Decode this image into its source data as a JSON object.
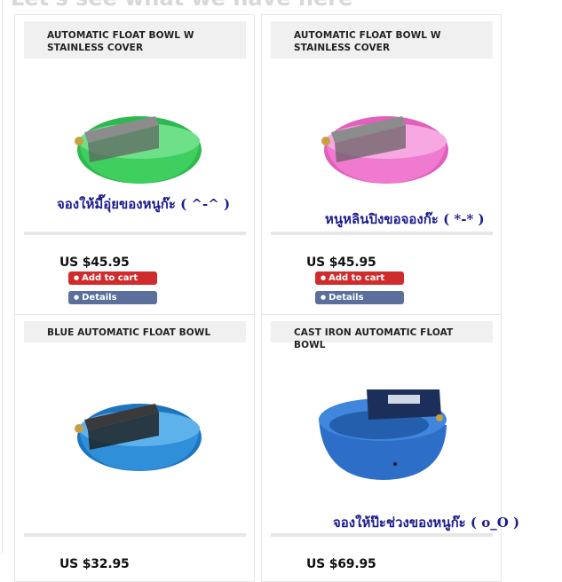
{
  "page": {
    "heading": "Let's see what we have here"
  },
  "products": [
    {
      "title": "AUTOMATIC FLOAT BOWL W STAINLESS COVER",
      "caption": "จองให้มี๊อุ่ยของหนูก๊ะ ( ^-^ )",
      "price": "US $45.95",
      "bowl_color": "#3ecf5e",
      "add_to_cart": "Add to cart",
      "details": "Details"
    },
    {
      "title": "AUTOMATIC FLOAT BOWL W STAINLESS COVER",
      "caption": "หนูหลินปิงขอจองก๊ะ ( *-* )",
      "price": "US $45.95",
      "bowl_color": "#f07ad0",
      "add_to_cart": "Add to cart",
      "details": "Details"
    },
    {
      "title": "BLUE AUTOMATIC FLOAT BOWL",
      "price": "US $32.95",
      "bowl_color": "#2f8fd8"
    },
    {
      "title": "CAST IRON AUTOMATIC FLOAT BOWL",
      "caption": "จองให้ป๊ะช่วงของหนูก๊ะ ( o_O )",
      "price": "US $69.95",
      "bowl_color": "#2d6ec8"
    }
  ]
}
